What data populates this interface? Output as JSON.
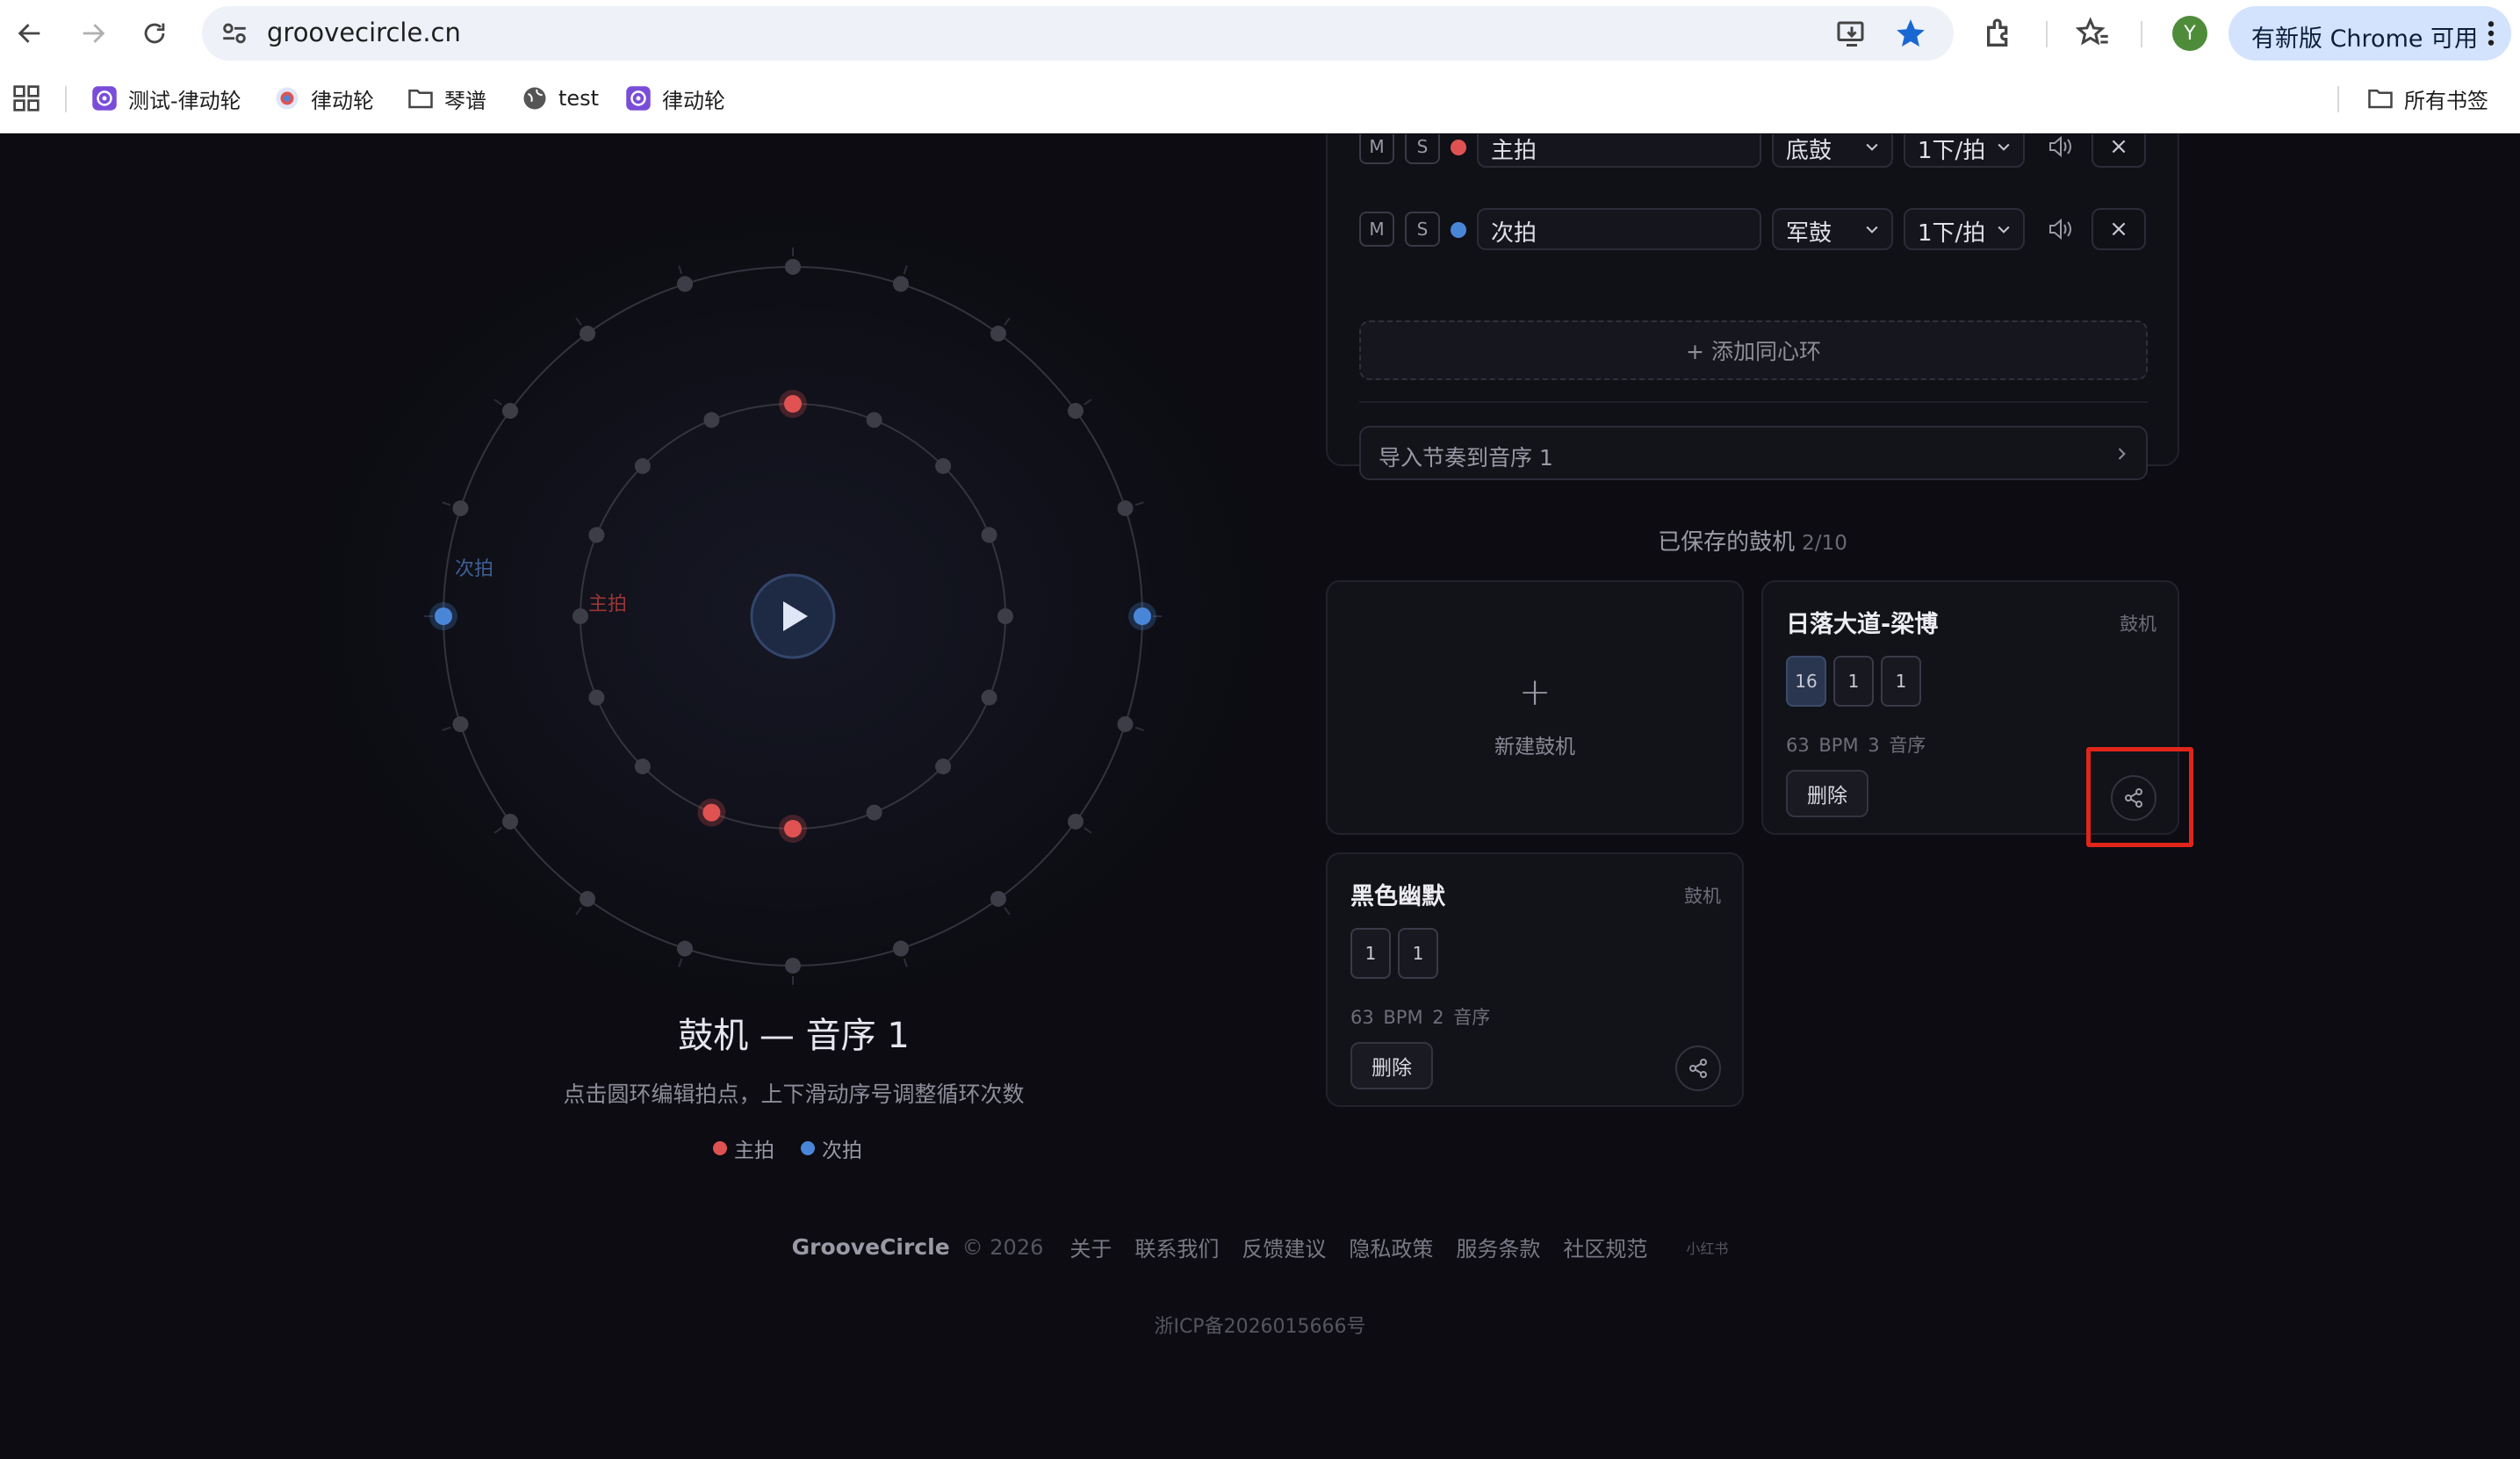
{
  "browser": {
    "url": "groovecircle.cn",
    "update_label": "有新版 Chrome 可用",
    "avatar_letter": "Y",
    "bookmarks": [
      {
        "label": "测试-律动轮",
        "icon": "app-icon"
      },
      {
        "label": "律动轮",
        "icon": "app-icon"
      },
      {
        "label": "琴谱",
        "icon": "folder-icon"
      },
      {
        "label": "test",
        "icon": "globe-icon"
      },
      {
        "label": "律动轮",
        "icon": "app-icon"
      }
    ],
    "all_bookmarks": "所有书签"
  },
  "circle": {
    "labels": {
      "outer": "次拍",
      "inner": "主拍"
    },
    "outer_beats": 20,
    "inner_beats": 16,
    "outer_active": [
      5,
      15
    ],
    "inner_active": [
      0,
      8,
      9
    ],
    "colors": {
      "main": "#e05252",
      "sub": "#4a86d8",
      "inactive": "#3d3d48"
    }
  },
  "machine": {
    "title": "鼓机 — 音序 1",
    "hint": "点击圆环编辑拍点，上下滑动序号调整循环次数",
    "legend": [
      {
        "label": "主拍",
        "color": "#e05252"
      },
      {
        "label": "次拍",
        "color": "#4a86d8"
      }
    ]
  },
  "tracks": [
    {
      "mute": "M",
      "solo": "S",
      "color": "#e05252",
      "name": "主拍",
      "instrument": "底鼓",
      "rate": "1下/拍"
    },
    {
      "mute": "M",
      "solo": "S",
      "color": "#4a86d8",
      "name": "次拍",
      "instrument": "军鼓",
      "rate": "1下/拍"
    }
  ],
  "delete_symbol": "×",
  "add_ring": "+ 添加同心环",
  "import_label": "导入节奏到音序 1",
  "saved": {
    "title": "已保存的鼓机",
    "count": "2/10",
    "new_plus": "+",
    "new_label": "新建鼓机",
    "cards": [
      {
        "title": "日落大道-梁博",
        "tag": "鼓机",
        "chips": [
          "16",
          "1",
          "1"
        ],
        "meta": "63 BPM   3 音序",
        "delete": "删除"
      },
      {
        "title": "黑色幽默",
        "tag": "鼓机",
        "chips": [
          "1",
          "1"
        ],
        "meta": "63 BPM   2 音序",
        "delete": "删除"
      }
    ]
  },
  "footer": {
    "brand": "GrooveCircle",
    "copyright": "© 2026",
    "links": [
      "关于",
      "联系我们",
      "反馈建议",
      "隐私政策",
      "服务条款",
      "社区规范"
    ],
    "xhs": "小红书",
    "icp": "浙ICP备2026015666号"
  }
}
